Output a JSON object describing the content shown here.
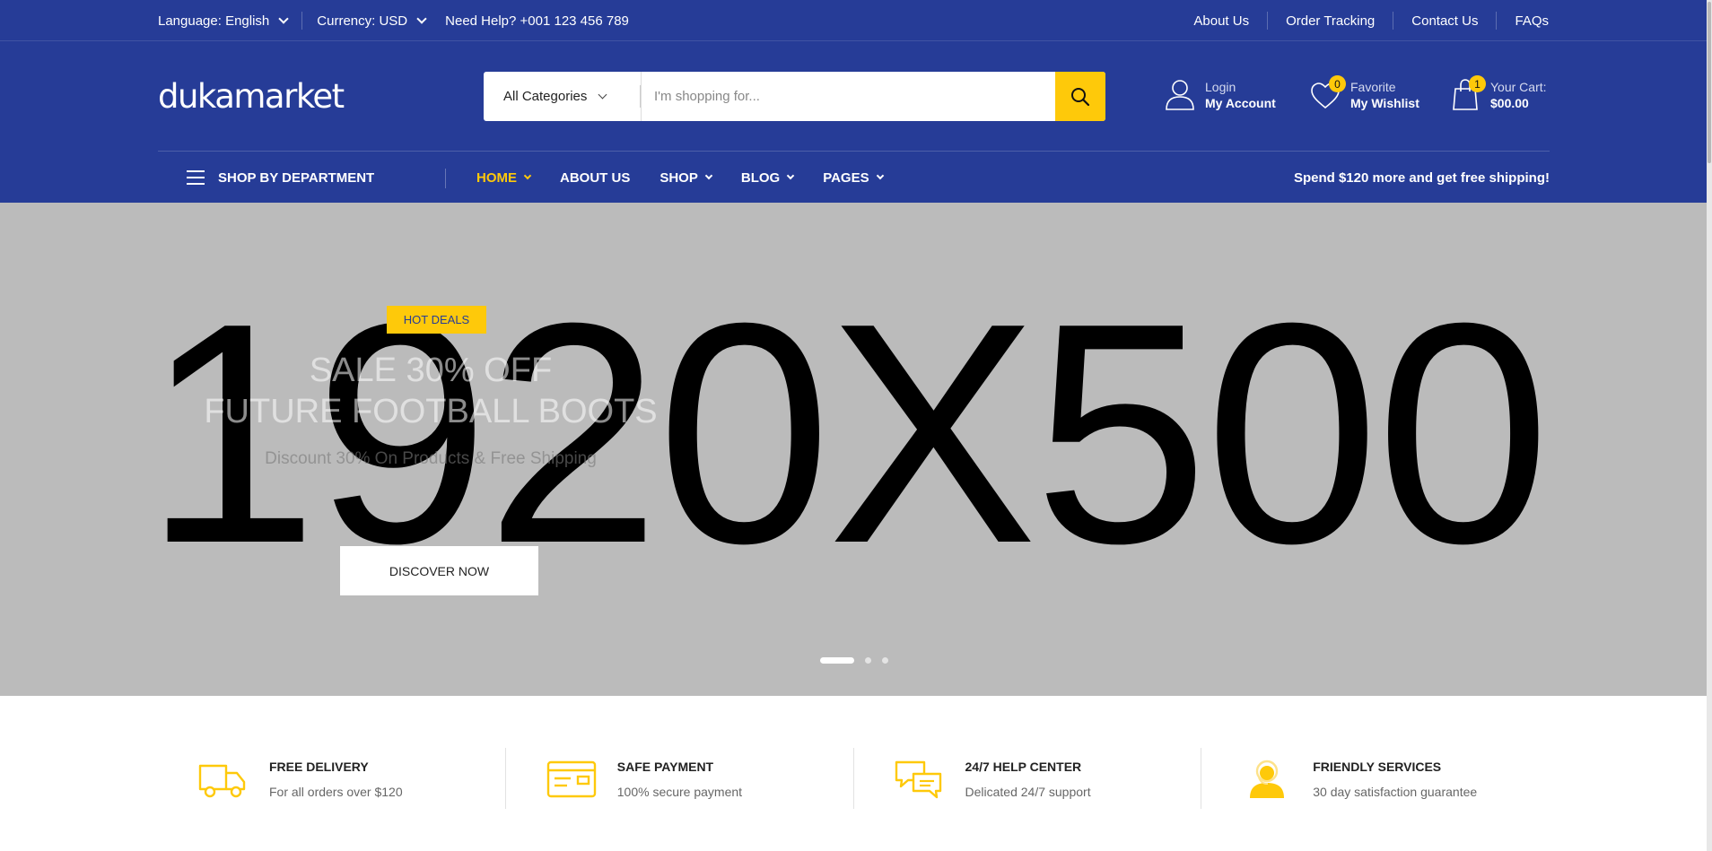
{
  "topbar": {
    "language": "Language: English",
    "currency": "Currency: USD",
    "help": "Need Help? +001 123 456 789",
    "links": [
      "About Us",
      "Order Tracking",
      "Contact Us",
      "FAQs"
    ]
  },
  "logo": "dukamarket",
  "search": {
    "category": "All Categories",
    "placeholder": "I'm shopping for..."
  },
  "account": {
    "line1": "Login",
    "line2": "My Account"
  },
  "wishlist": {
    "count": "0",
    "line1": "Favorite",
    "line2": "My Wishlist"
  },
  "cart": {
    "count": "1",
    "line1": "Your Cart:",
    "line2": "$00.00"
  },
  "nav": {
    "department": "SHOP BY DEPARTMENT",
    "items": [
      "HOME",
      "ABOUT US",
      "SHOP",
      "BLOG",
      "PAGES"
    ],
    "promo": "Spend $120 more and get free shipping!"
  },
  "hero": {
    "placeholder": "1920X500",
    "badge": "HOT DEALS",
    "title_line1": "SALE 30% OFF",
    "title_line2": "FUTURE FOOTBALL BOOTS",
    "subtitle": "Discount 30% On Products & Free Shipping",
    "cta": "DISCOVER NOW",
    "slides_total": 3,
    "active_slide": 1
  },
  "features": [
    {
      "icon": "delivery-truck-icon",
      "title": "FREE DELIVERY",
      "desc": "For all orders over $120"
    },
    {
      "icon": "credit-card-icon",
      "title": "SAFE PAYMENT",
      "desc": "100% secure payment"
    },
    {
      "icon": "chat-bubbles-icon",
      "title": "24/7 HELP CENTER",
      "desc": "Delicated 24/7 support"
    },
    {
      "icon": "support-agent-icon",
      "title": "FRIENDLY SERVICES",
      "desc": "30 day satisfaction guarantee"
    }
  ],
  "colors": {
    "brand": "#263c97",
    "accent": "#fec90a",
    "hero_bg": "#bbbbbb"
  }
}
